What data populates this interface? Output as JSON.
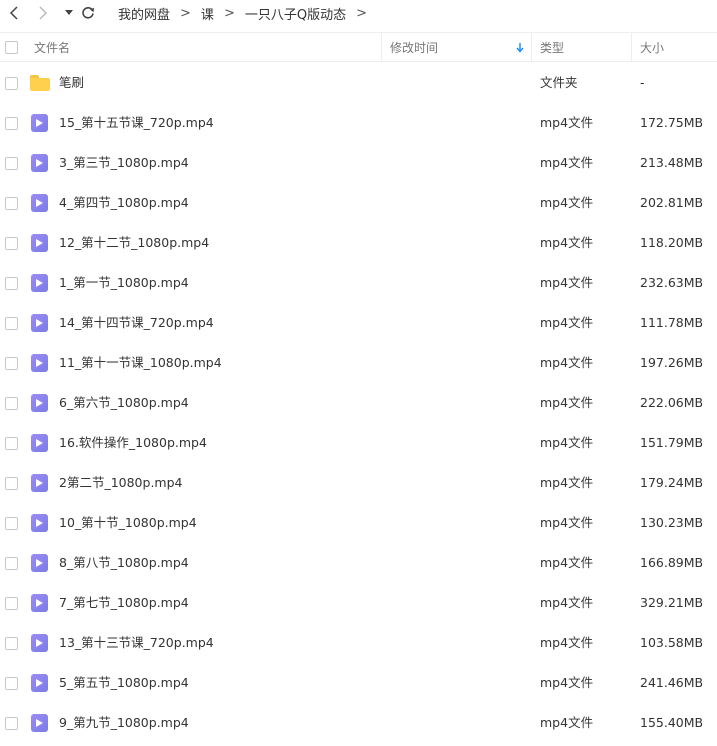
{
  "breadcrumb": [
    "我的网盘",
    "课",
    "一只八子Q版动态"
  ],
  "breadcrumb_separator": ">",
  "columns": {
    "name": "文件名",
    "modified": "修改时间",
    "type": "类型",
    "size": "大小"
  },
  "colors": {
    "accent": "#1e90ff",
    "video_icon": "#8a83ee",
    "folder_icon": "#ffd04d"
  },
  "icons": {
    "back": "chevron-left-icon",
    "forward": "chevron-right-icon",
    "dropdown": "caret-down-icon",
    "refresh": "refresh-icon",
    "sort": "arrow-down-icon",
    "folder": "folder-icon",
    "video": "video-file-icon"
  },
  "files": [
    {
      "name": "笔刷",
      "type": "文件夹",
      "size": "-",
      "kind": "folder"
    },
    {
      "name": "15_第十五节课_720p.mp4",
      "type": "mp4文件",
      "size": "172.75MB",
      "kind": "video"
    },
    {
      "name": "3_第三节_1080p.mp4",
      "type": "mp4文件",
      "size": "213.48MB",
      "kind": "video"
    },
    {
      "name": "4_第四节_1080p.mp4",
      "type": "mp4文件",
      "size": "202.81MB",
      "kind": "video"
    },
    {
      "name": "12_第十二节_1080p.mp4",
      "type": "mp4文件",
      "size": "118.20MB",
      "kind": "video"
    },
    {
      "name": "1_第一节_1080p.mp4",
      "type": "mp4文件",
      "size": "232.63MB",
      "kind": "video"
    },
    {
      "name": "14_第十四节课_720p.mp4",
      "type": "mp4文件",
      "size": "111.78MB",
      "kind": "video"
    },
    {
      "name": "11_第十一节课_1080p.mp4",
      "type": "mp4文件",
      "size": "197.26MB",
      "kind": "video"
    },
    {
      "name": "6_第六节_1080p.mp4",
      "type": "mp4文件",
      "size": "222.06MB",
      "kind": "video"
    },
    {
      "name": "16.软件操作_1080p.mp4",
      "type": "mp4文件",
      "size": "151.79MB",
      "kind": "video"
    },
    {
      "name": "2第二节_1080p.mp4",
      "type": "mp4文件",
      "size": "179.24MB",
      "kind": "video"
    },
    {
      "name": "10_第十节_1080p.mp4",
      "type": "mp4文件",
      "size": "130.23MB",
      "kind": "video"
    },
    {
      "name": "8_第八节_1080p.mp4",
      "type": "mp4文件",
      "size": "166.89MB",
      "kind": "video"
    },
    {
      "name": "7_第七节_1080p.mp4",
      "type": "mp4文件",
      "size": "329.21MB",
      "kind": "video"
    },
    {
      "name": "13_第十三节课_720p.mp4",
      "type": "mp4文件",
      "size": "103.58MB",
      "kind": "video"
    },
    {
      "name": "5_第五节_1080p.mp4",
      "type": "mp4文件",
      "size": "241.46MB",
      "kind": "video"
    },
    {
      "name": "9_第九节_1080p.mp4",
      "type": "mp4文件",
      "size": "155.40MB",
      "kind": "video"
    }
  ]
}
